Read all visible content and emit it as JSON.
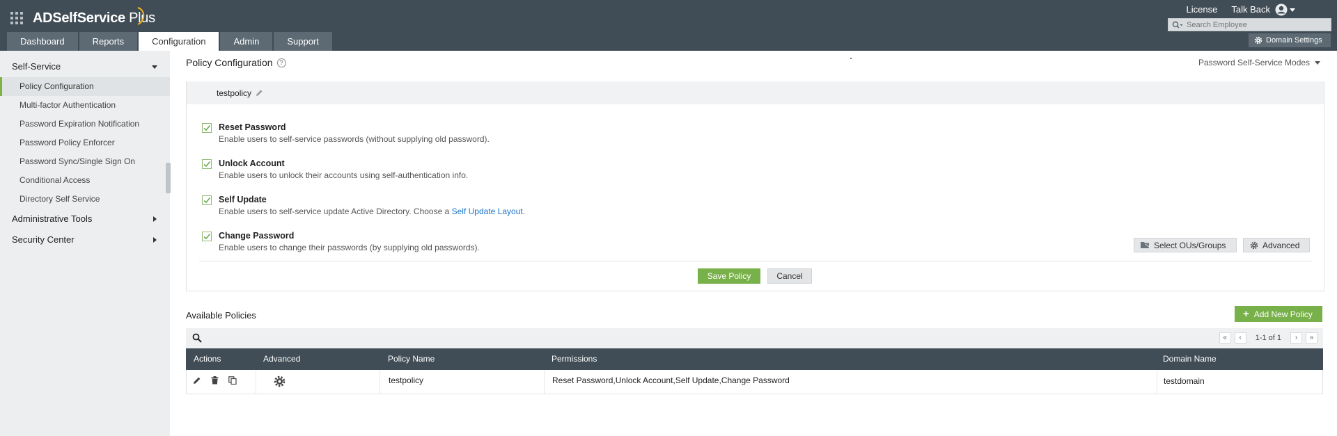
{
  "app": {
    "brand_name": "ADSelfService",
    "brand_suffix": "Plus",
    "top_links": [
      "License",
      "Talk Back"
    ],
    "search_placeholder": "Search Employee",
    "domain_settings": "Domain Settings"
  },
  "nav": {
    "tabs": [
      "Dashboard",
      "Reports",
      "Configuration",
      "Admin",
      "Support"
    ],
    "active_tab": "Configuration"
  },
  "sidebar": {
    "sections": [
      "Self-Service",
      "Administrative Tools",
      "Security Center"
    ],
    "items": [
      "Policy Configuration",
      "Multi-factor Authentication",
      "Password Expiration Notification",
      "Password Policy Enforcer",
      "Password Sync/Single Sign On",
      "Conditional Access",
      "Directory Self Service"
    ],
    "active_item": "Policy Configuration"
  },
  "page": {
    "title": "Policy Configuration",
    "modes_label": "Password Self-Service Modes",
    "policy_name": "testpolicy"
  },
  "options": [
    {
      "title": "Reset Password",
      "desc": "Enable users to self-service passwords (without supplying old password).",
      "checked": true
    },
    {
      "title": "Unlock Account",
      "desc": "Enable users to unlock their accounts using self-authentication info.",
      "checked": true
    },
    {
      "title": "Self Update",
      "desc": "Enable users to self-service update Active Directory. Choose a",
      "link": "Self Update Layout",
      "desc_end": ".",
      "checked": true
    },
    {
      "title": "Change Password",
      "desc": "Enable users to change their passwords (by supplying old passwords).",
      "checked": true
    }
  ],
  "buttons": {
    "select_ous": "Select OUs/Groups",
    "advanced": "Advanced",
    "save": "Save Policy",
    "cancel": "Cancel",
    "add_new": "Add New Policy"
  },
  "available": {
    "title": "Available Policies",
    "pager_text": "1-1 of 1",
    "columns": [
      "Actions",
      "Advanced",
      "Policy Name",
      "Permissions",
      "Domain Name"
    ],
    "rows": [
      {
        "policy_name": "testpolicy",
        "permissions": "Reset Password,Unlock Account,Self Update,Change Password",
        "domain": "testdomain"
      }
    ]
  },
  "colors": {
    "header": "#414d56",
    "tab": "#5d6a73",
    "accent_green": "#78b04a",
    "link": "#1a73c8"
  }
}
